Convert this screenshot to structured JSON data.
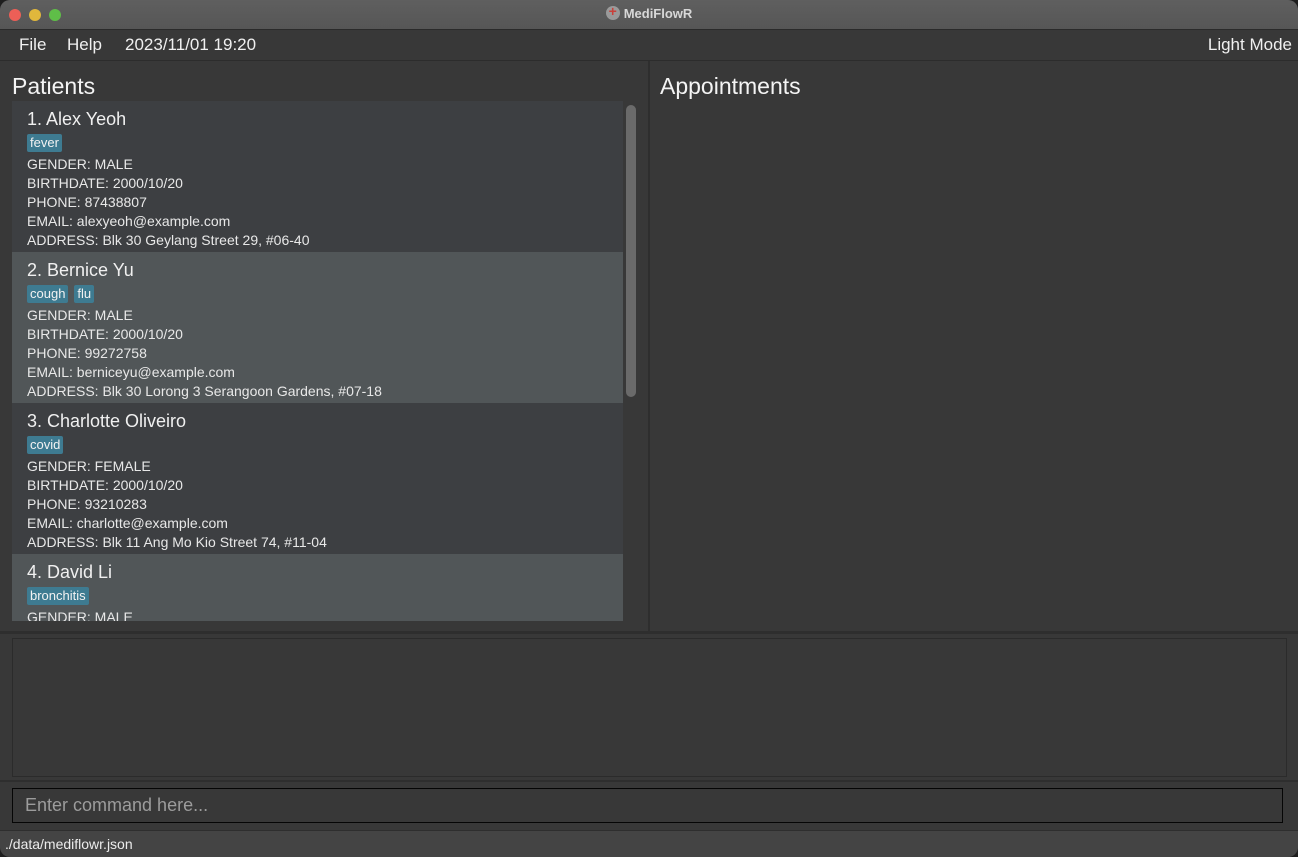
{
  "window": {
    "title": "MediFlowR",
    "app_icon": "medical-cross-icon"
  },
  "menubar": {
    "file": "File",
    "help": "Help",
    "datetime": "2023/11/01 19:20",
    "mode_toggle": "Light Mode"
  },
  "patients": {
    "title": "Patients",
    "items": [
      {
        "name": "1.  Alex Yeoh",
        "tags": [
          "fever"
        ],
        "gender": "GENDER: MALE",
        "birthdate": "BIRTHDATE: 2000/10/20",
        "phone": "PHONE: 87438807",
        "email": "EMAIL: alexyeoh@example.com",
        "address": "ADDRESS: Blk 30 Geylang Street 29, #06-40"
      },
      {
        "name": "2.  Bernice Yu",
        "tags": [
          "cough",
          "flu"
        ],
        "gender": "GENDER: MALE",
        "birthdate": "BIRTHDATE: 2000/10/20",
        "phone": "PHONE: 99272758",
        "email": "EMAIL: berniceyu@example.com",
        "address": "ADDRESS: Blk 30 Lorong 3 Serangoon Gardens, #07-18"
      },
      {
        "name": "3.  Charlotte Oliveiro",
        "tags": [
          "covid"
        ],
        "gender": "GENDER: FEMALE",
        "birthdate": "BIRTHDATE: 2000/10/20",
        "phone": "PHONE: 93210283",
        "email": "EMAIL: charlotte@example.com",
        "address": "ADDRESS: Blk 11 Ang Mo Kio Street 74, #11-04"
      },
      {
        "name": "4.  David Li",
        "tags": [
          "bronchitis"
        ],
        "gender": "GENDER: MALE",
        "birthdate": "",
        "phone": "",
        "email": "",
        "address": ""
      }
    ]
  },
  "appointments": {
    "title": "Appointments"
  },
  "result_display": {
    "text": ""
  },
  "command_box": {
    "value": "",
    "placeholder": "Enter command here..."
  },
  "statusbar": {
    "path": "./data/mediflowr.json"
  },
  "colors": {
    "tag": "#3e7b91",
    "background": "#383838",
    "card_odd": "#3d3f42",
    "card_even": "#515658"
  }
}
